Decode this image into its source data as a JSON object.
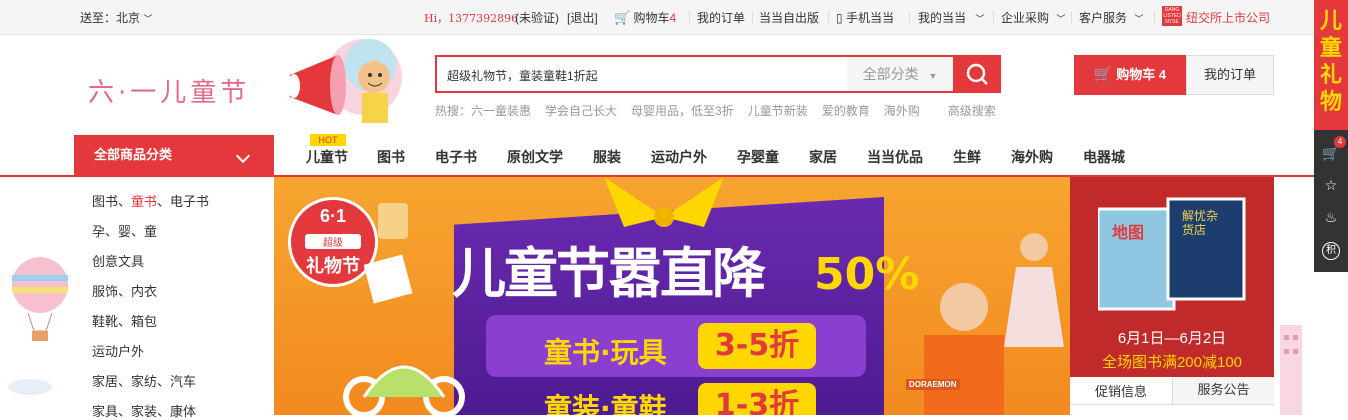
{
  "topbar": {
    "ship_to": "送至：北京",
    "greeting": "Hi，13773928​96",
    "unverified": "(未验证)",
    "logout": "[退出]",
    "cart": "购物车",
    "cart_count": "4",
    "my_orders": "我的订单",
    "self_publish": "当当自出版",
    "mobile": "手机当当",
    "my_dangdang": "我的当当",
    "enterprise": "企业采购",
    "service": "客户服务",
    "nyse_text": "纽交所上市公司",
    "nyse_logo": "DANG LISTED NYSE"
  },
  "header": {
    "logo": "六·一儿童节",
    "search_value": "超级礼物节，童装童鞋1折起",
    "search_category": "全部分类",
    "hot_label": "热搜：",
    "hot_terms": [
      "六一童装惠",
      "学会自己长大",
      "母婴用品，低至3折",
      "儿童节新装",
      "爱的教育",
      "海外购",
      "高级搜索"
    ],
    "cart_button": "购物车 4",
    "order_button": "我的订单"
  },
  "nav": {
    "all_categories": "全部商品分类",
    "hot_tag": "HOT",
    "items": [
      "儿童节",
      "图书",
      "电子书",
      "原创文学",
      "服装",
      "运动户外",
      "孕婴童",
      "家居",
      "当当优品",
      "生鲜",
      "海外购",
      "电器城"
    ]
  },
  "categories": {
    "row1_a": "图书、",
    "row1_b": "童书",
    "row1_c": "、电子书",
    "row2": "孕、婴、童",
    "rows": [
      "创意文具",
      "服饰、内衣",
      "鞋靴、箱包",
      "运动户外",
      "家居、家纺、汽车",
      "家具、家装、康体"
    ]
  },
  "banner": {
    "badge_top": "6·1",
    "badge_mid": "超级",
    "badge_bottom": "礼物节",
    "title": "儿童节嚣直降",
    "percent": "50%",
    "line1": "童书·玩具",
    "discount1": "3-5折",
    "line2": "童装·童鞋",
    "discount2": "1-3折",
    "shirt_text": "DORAEMON"
  },
  "side_ad": {
    "book1": "地图",
    "book2": "解忧杂货店",
    "date": "6月1日—6月2日",
    "promo": "全场图书满200减100"
  },
  "tabs": [
    "促销信息",
    "服务公告"
  ],
  "right_rail": {
    "promo": "儿童礼物",
    "cart_badge": "4",
    "points": "积"
  }
}
